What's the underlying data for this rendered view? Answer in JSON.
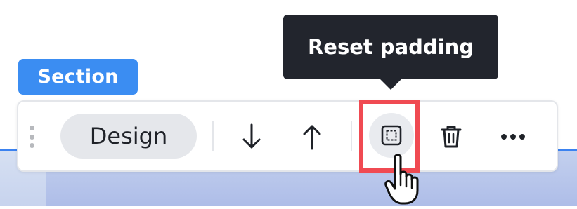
{
  "section_label": "Section",
  "toolbar": {
    "design_label": "Design",
    "icons": [
      "drag-handle-icon",
      "arrow-down-icon",
      "arrow-up-icon",
      "reset-padding-icon",
      "trash-icon",
      "more-icon"
    ]
  },
  "tooltip": {
    "text": "Reset padding"
  },
  "colors": {
    "section_badge": "#3b8df2",
    "tooltip_bg": "#22252d",
    "highlight": "#f04a52",
    "canvas_border": "#3b82f0"
  }
}
